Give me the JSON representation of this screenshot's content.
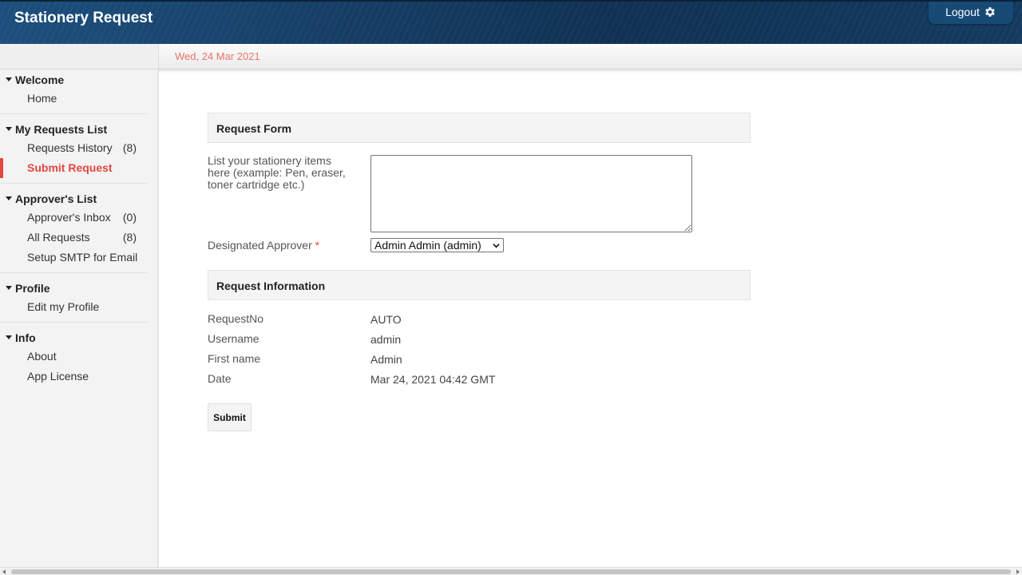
{
  "header": {
    "title": "Stationery Request",
    "logout_label": "Logout",
    "logout_icon": "gear-icon"
  },
  "datebar": {
    "date": "Wed, 24 Mar 2021"
  },
  "sidebar": {
    "sections": [
      {
        "title": "Welcome",
        "items": [
          {
            "label": "Home",
            "count": ""
          }
        ]
      },
      {
        "title": "My Requests List",
        "items": [
          {
            "label": "Requests History",
            "count": "(8)"
          },
          {
            "label": "Submit Request",
            "count": "",
            "active": true
          }
        ]
      },
      {
        "title": "Approver's List",
        "items": [
          {
            "label": "Approver's Inbox",
            "count": "(0)"
          },
          {
            "label": "All Requests",
            "count": "(8)"
          },
          {
            "label": "Setup SMTP for Email",
            "count": ""
          }
        ]
      },
      {
        "title": "Profile",
        "items": [
          {
            "label": "Edit my Profile",
            "count": ""
          }
        ]
      },
      {
        "title": "Info",
        "items": [
          {
            "label": "About",
            "count": ""
          },
          {
            "label": "App License",
            "count": ""
          }
        ]
      }
    ]
  },
  "form": {
    "request_form_title": "Request Form",
    "items_label": "List your stationery items here (example: Pen, eraser, toner cartridge etc.)",
    "items_value": "",
    "approver_label": "Designated Approver",
    "required_mark": "*",
    "approver_selected": "Admin Admin (admin)",
    "request_info_title": "Request Information",
    "info": [
      {
        "label": "RequestNo",
        "value": "AUTO"
      },
      {
        "label": "Username",
        "value": "admin"
      },
      {
        "label": "First name",
        "value": "Admin"
      },
      {
        "label": "Date",
        "value": "Mar 24, 2021 04:42 GMT"
      }
    ],
    "submit_label": "Submit"
  },
  "colors": {
    "accent": "#e2473f",
    "date_text": "#e8756a",
    "header_bg": "#163f67"
  }
}
